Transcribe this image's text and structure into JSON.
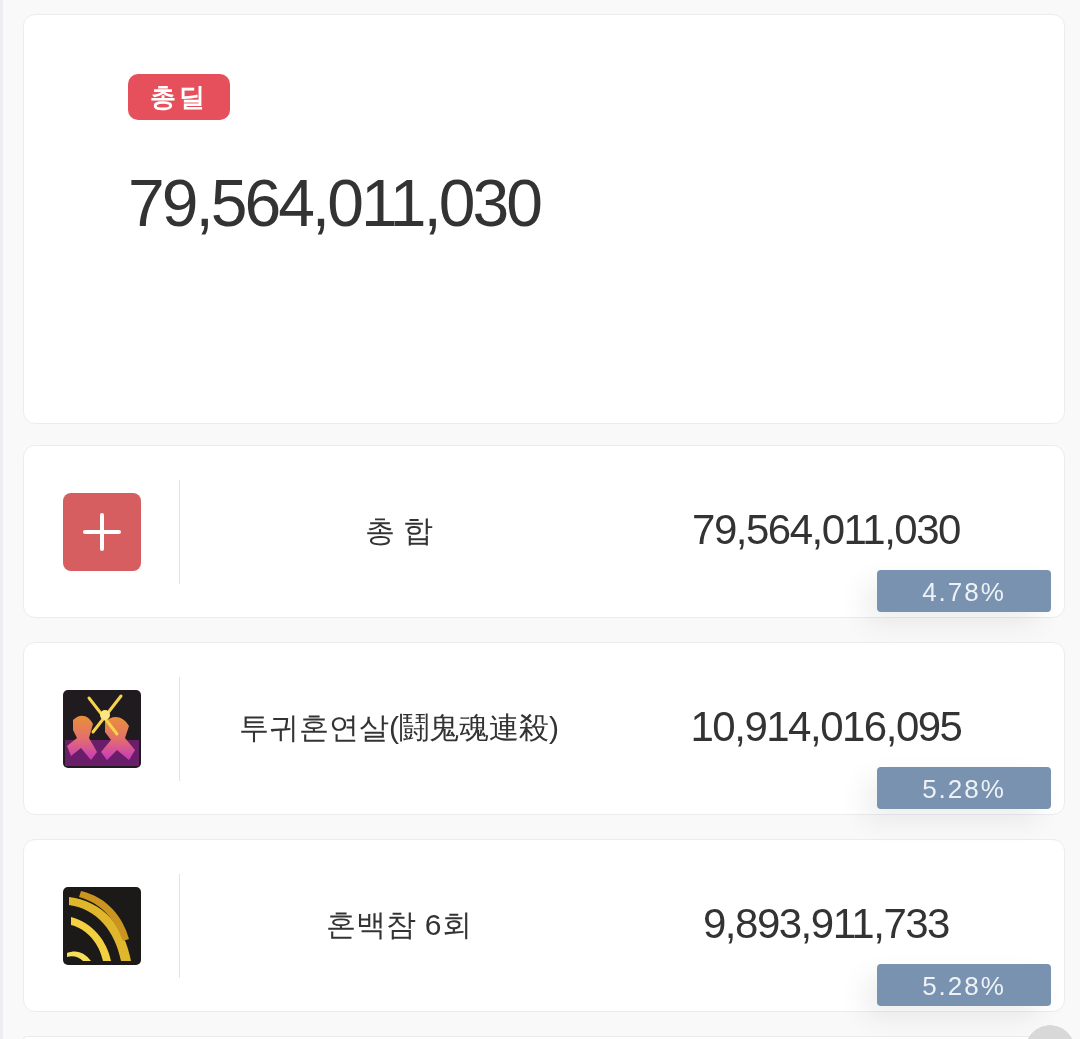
{
  "summary": {
    "badge": "총딜",
    "total": "79,564,011,030"
  },
  "rows": [
    {
      "kind": "total",
      "name": "총 합",
      "value": "79,564,011,030",
      "share": "4.78%"
    },
    {
      "kind": "skill",
      "name": "투귀혼연살(鬪鬼魂連殺)",
      "value": "10,914,016,095",
      "share": "5.28%"
    },
    {
      "kind": "skill",
      "name": "혼백참 6회",
      "value": "9,893,911,733",
      "share": "5.28%"
    }
  ]
}
